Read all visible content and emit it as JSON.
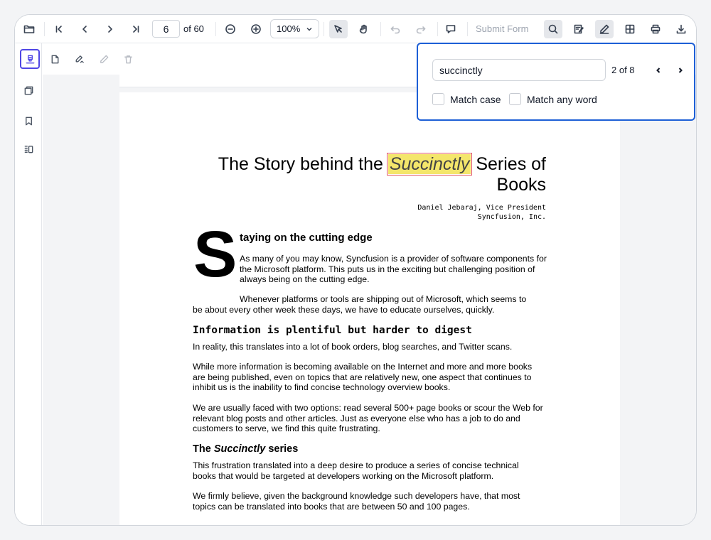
{
  "toolbar": {
    "current_page": "6",
    "page_of": "of 60",
    "zoom": "100%",
    "submit_form": "Submit Form"
  },
  "find": {
    "query": "succinctly",
    "count": "2 of 8",
    "match_case": "Match case",
    "match_any_word": "Match any word"
  },
  "document": {
    "title_before": "The Story behind the ",
    "title_highlight": "Succinctly",
    "title_after": " Series of Books",
    "author_line1": "Daniel Jebaraj, Vice President",
    "author_line2": "Syncfusion, Inc.",
    "dropcap": "S",
    "heading1": "taying on the cutting edge",
    "para1": "As many of you may know, Syncfusion is a provider of software components for the Microsoft platform. This puts us in the exciting but challenging position of always being on the cutting edge.",
    "para2_line1": "Whenever platforms or tools are shipping out of Microsoft, which seems to",
    "para2_line2": "be about every other week these days, we have to educate ourselves, quickly.",
    "heading2": "Information is plentiful but harder to digest",
    "para3": "In reality, this translates into a lot of book orders, blog searches, and Twitter scans.",
    "para4": "While more information is becoming available on the Internet and more and more books are being published, even on topics that are relatively new, one aspect that continues to inhibit us is the inability to find concise technology overview books.",
    "para5": "We are usually faced with two options: read several 500+ page books or scour the Web for relevant blog posts and other articles. Just as everyone else who has a job to do and customers to serve, we find this quite frustrating.",
    "heading3_prefix": "The ",
    "heading3_italic": "Succinctly",
    "heading3_suffix": " series",
    "para6": "This frustration translated into a deep desire to produce a series of concise technical books that would be targeted at developers working on the Microsoft platform.",
    "para7": "We firmly believe, given the background knowledge such developers have, that most topics can be translated into books that are between 50 and 100 pages."
  },
  "colors": {
    "highlight": "#f4e66b",
    "highlight_border": "#e0525b",
    "find_panel_border": "#1d5fd6",
    "selected_tool_border": "#4f46e5"
  }
}
